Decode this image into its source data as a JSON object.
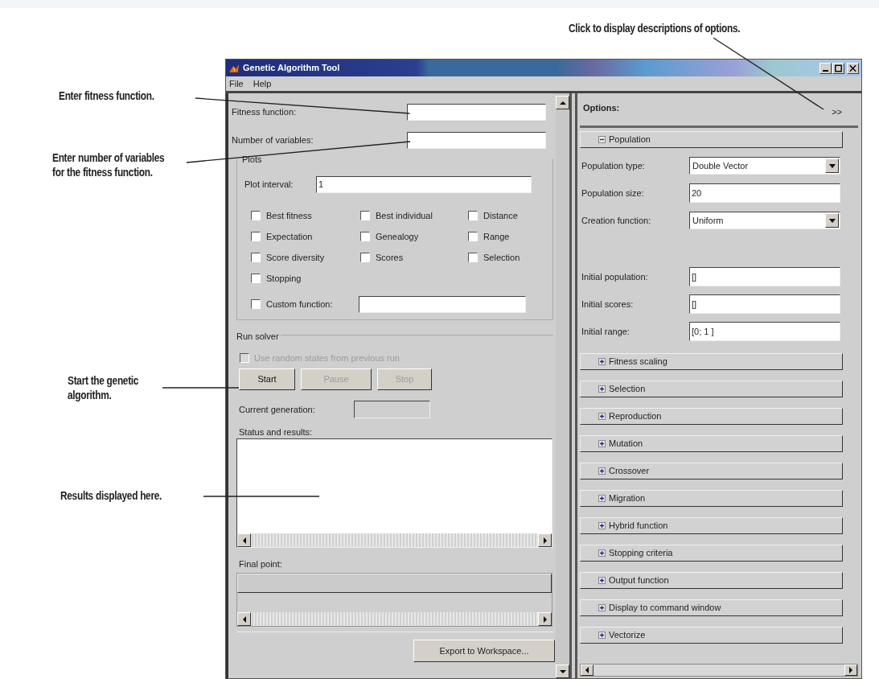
{
  "annotations": [
    {
      "text": "Click to display descriptions of options."
    },
    {
      "text": "Enter fitness function."
    },
    {
      "text": "Enter number of variables for the fitness function."
    },
    {
      "text": "Start the genetic algorithm."
    },
    {
      "text": "Results displayed here."
    }
  ],
  "window": {
    "title": "Genetic Algorithm Tool",
    "menu": [
      "File",
      "Help"
    ]
  },
  "problem": [
    {
      "label": "Fitness function:"
    },
    {
      "label": "Number of variables:"
    }
  ],
  "plots": {
    "title": "Plots",
    "plot_interval": {
      "label": "Plot interval:",
      "value": "1"
    },
    "checkboxes": [
      {
        "label": "Best fitness",
        "checked": false
      },
      {
        "label": "Best individual",
        "checked": false
      },
      {
        "label": "Distance",
        "checked": false
      },
      {
        "label": "Expectation",
        "checked": false
      },
      {
        "label": "Genealogy",
        "checked": false
      },
      {
        "label": "Range",
        "checked": false
      },
      {
        "label": "Score diversity",
        "checked": false
      },
      {
        "label": "Scores",
        "checked": false
      },
      {
        "label": "Selection",
        "checked": false
      },
      {
        "label": "Stopping",
        "checked": false
      }
    ],
    "custom_function": {
      "label": "Custom function:",
      "checked": false
    }
  },
  "run_solver": {
    "title": "Run solver",
    "use_random_states": {
      "label": "Use random states from previous run",
      "checked": false,
      "disabled": true
    },
    "buttons": [
      {
        "label": "Start",
        "disabled": false
      },
      {
        "label": "Pause",
        "disabled": true
      },
      {
        "label": "Stop",
        "disabled": true
      }
    ],
    "current_generation": {
      "label": "Current generation:"
    },
    "status": {
      "label": "Status and results:"
    },
    "final_point": {
      "label": "Final point:"
    }
  },
  "export_button": {
    "label": "Export to Workspace..."
  },
  "options": {
    "title": "Options:",
    "more": ">>",
    "sections": [
      {
        "label": "Population",
        "expanded": true,
        "fields": [
          {
            "kind": "dropdown",
            "label": "Population type:",
            "value": "Double Vector"
          },
          {
            "kind": "text",
            "label": "Population size:",
            "value": "20"
          },
          {
            "kind": "dropdown",
            "label": "Creation function:",
            "value": "Uniform"
          },
          {
            "kind": "spacer"
          },
          {
            "kind": "text",
            "label": "Initial population:",
            "value": "[]"
          },
          {
            "kind": "text",
            "label": "Initial scores:",
            "value": "[]"
          },
          {
            "kind": "text",
            "label": "Initial range:",
            "value": "[0; 1 ]"
          }
        ]
      },
      {
        "label": "Fitness scaling",
        "expanded": false
      },
      {
        "label": "Selection",
        "expanded": false
      },
      {
        "label": "Reproduction",
        "expanded": false
      },
      {
        "label": "Mutation",
        "expanded": false
      },
      {
        "label": "Crossover",
        "expanded": false
      },
      {
        "label": "Migration",
        "expanded": false
      },
      {
        "label": "Hybrid function",
        "expanded": false
      },
      {
        "label": "Stopping criteria",
        "expanded": false
      },
      {
        "label": "Output function",
        "expanded": false
      },
      {
        "label": "Display to command window",
        "expanded": false
      },
      {
        "label": "Vectorize",
        "expanded": false
      }
    ]
  }
}
